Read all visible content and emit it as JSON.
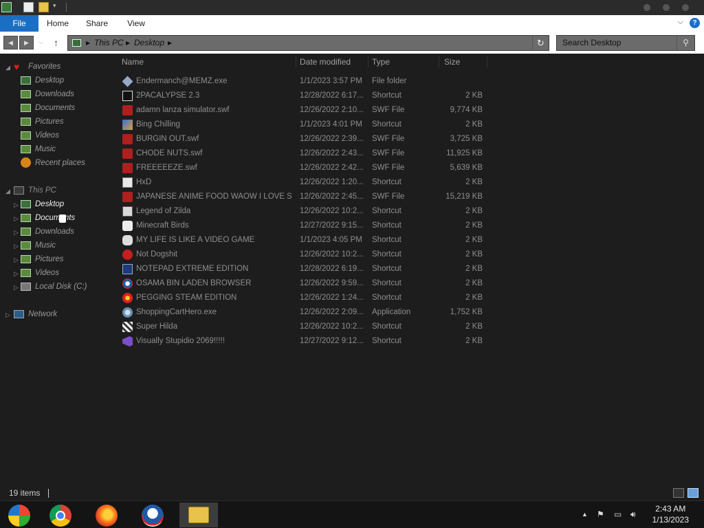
{
  "window": {
    "ribbon_tabs": [
      "File",
      "Home",
      "Share",
      "View"
    ]
  },
  "address_bar": {
    "breadcrumbs": [
      "This PC",
      "Desktop"
    ]
  },
  "search": {
    "placeholder": "Search Desktop"
  },
  "nav_pane": {
    "favorites_label": "Favorites",
    "favorites": [
      "Desktop",
      "Downloads",
      "Documents",
      "Pictures",
      "Videos",
      "Music",
      "Recent places"
    ],
    "this_pc_label": "This PC",
    "this_pc": [
      "Desktop",
      "Documents",
      "Downloads",
      "Music",
      "Pictures",
      "Videos",
      "Local Disk (C:)"
    ],
    "network_label": "Network"
  },
  "columns": {
    "name": "Name",
    "date": "Date modified",
    "type": "Type",
    "size": "Size"
  },
  "files": [
    {
      "name": "Endermanch@MEMZ.exe",
      "date": "1/1/2023 3:57 PM",
      "type": "File folder",
      "size": "",
      "icon": "exe-diamond-icon"
    },
    {
      "name": "2PACALYPSE 2.3",
      "date": "12/28/2022 6:17...",
      "type": "Shortcut",
      "size": "2 KB",
      "icon": "console-icon"
    },
    {
      "name": "adamn lanza simulator.swf",
      "date": "12/26/2022 2:10...",
      "type": "SWF File",
      "size": "9,774 KB",
      "icon": "flash-icon"
    },
    {
      "name": "Bing Chilling",
      "date": "1/1/2023 4:01 PM",
      "type": "Shortcut",
      "size": "2 KB",
      "icon": "image-shortcut-icon"
    },
    {
      "name": "BURGIN OUT.swf",
      "date": "12/26/2022 2:39...",
      "type": "SWF File",
      "size": "3,725 KB",
      "icon": "flash-icon"
    },
    {
      "name": "CHODE NUTS.swf",
      "date": "12/26/2022 2:43...",
      "type": "SWF File",
      "size": "11,925 KB",
      "icon": "flash-icon"
    },
    {
      "name": "FREEEEEZE.swf",
      "date": "12/26/2022 2:42...",
      "type": "SWF File",
      "size": "5,639 KB",
      "icon": "flash-icon"
    },
    {
      "name": "HxD",
      "date": "12/26/2022 1:20...",
      "type": "Shortcut",
      "size": "2 KB",
      "icon": "hex-editor-icon"
    },
    {
      "name": "JAPANESE ANIME FOOD WAOW I LOVE SU...",
      "date": "12/26/2022 2:45...",
      "type": "SWF File",
      "size": "15,219 KB",
      "icon": "flash-icon"
    },
    {
      "name": "Legend of Zilda",
      "date": "12/26/2022 10:2...",
      "type": "Shortcut",
      "size": "2 KB",
      "icon": "game-shortcut-icon"
    },
    {
      "name": "Minecraft Birds",
      "date": "12/27/2022 9:15...",
      "type": "Shortcut",
      "size": "2 KB",
      "icon": "bird-icon"
    },
    {
      "name": "MY LIFE IS LIKE A VIDEO GAME",
      "date": "1/1/2023 4:05 PM",
      "type": "Shortcut",
      "size": "2 KB",
      "icon": "gamepad-icon"
    },
    {
      "name": "Not Dogshit",
      "date": "12/26/2022 10:2...",
      "type": "Shortcut",
      "size": "2 KB",
      "icon": "red-badge-icon"
    },
    {
      "name": "NOTEPAD EXTREME EDITION",
      "date": "12/28/2022 6:19...",
      "type": "Shortcut",
      "size": "2 KB",
      "icon": "notepad-icon"
    },
    {
      "name": "OSAMA BIN LADEN BROWSER",
      "date": "12/26/2022 9:59...",
      "type": "Shortcut",
      "size": "2 KB",
      "icon": "browser-logo-icon"
    },
    {
      "name": "PEGGING STEAM EDITION",
      "date": "12/26/2022 1:24...",
      "type": "Shortcut",
      "size": "2 KB",
      "icon": "browser-red-icon"
    },
    {
      "name": "ShoppingCartHero.exe",
      "date": "12/26/2022 2:09...",
      "type": "Application",
      "size": "1,752 KB",
      "icon": "application-icon"
    },
    {
      "name": "Super Hilda",
      "date": "12/26/2022 10:2...",
      "type": "Shortcut",
      "size": "2 KB",
      "icon": "pixel-game-icon"
    },
    {
      "name": "Visually Stupidio 2069!!!!!",
      "date": "12/27/2022 9:12...",
      "type": "Shortcut",
      "size": "2 KB",
      "icon": "visual-studio-icon"
    }
  ],
  "status_bar": {
    "item_count": "19 items"
  },
  "taskbar": {
    "apps": [
      "start-orb-icon",
      "chrome-icon",
      "firefox-icon",
      "obama-browser-icon",
      "file-explorer-icon"
    ],
    "time": "2:43 AM",
    "date": "1/13/2023"
  },
  "colors": {
    "background": "#1d1d1d",
    "ribbon_file_tab": "#1a6fc4",
    "row_text": "#8f8f8f",
    "flash_red": "#b01e1e"
  }
}
